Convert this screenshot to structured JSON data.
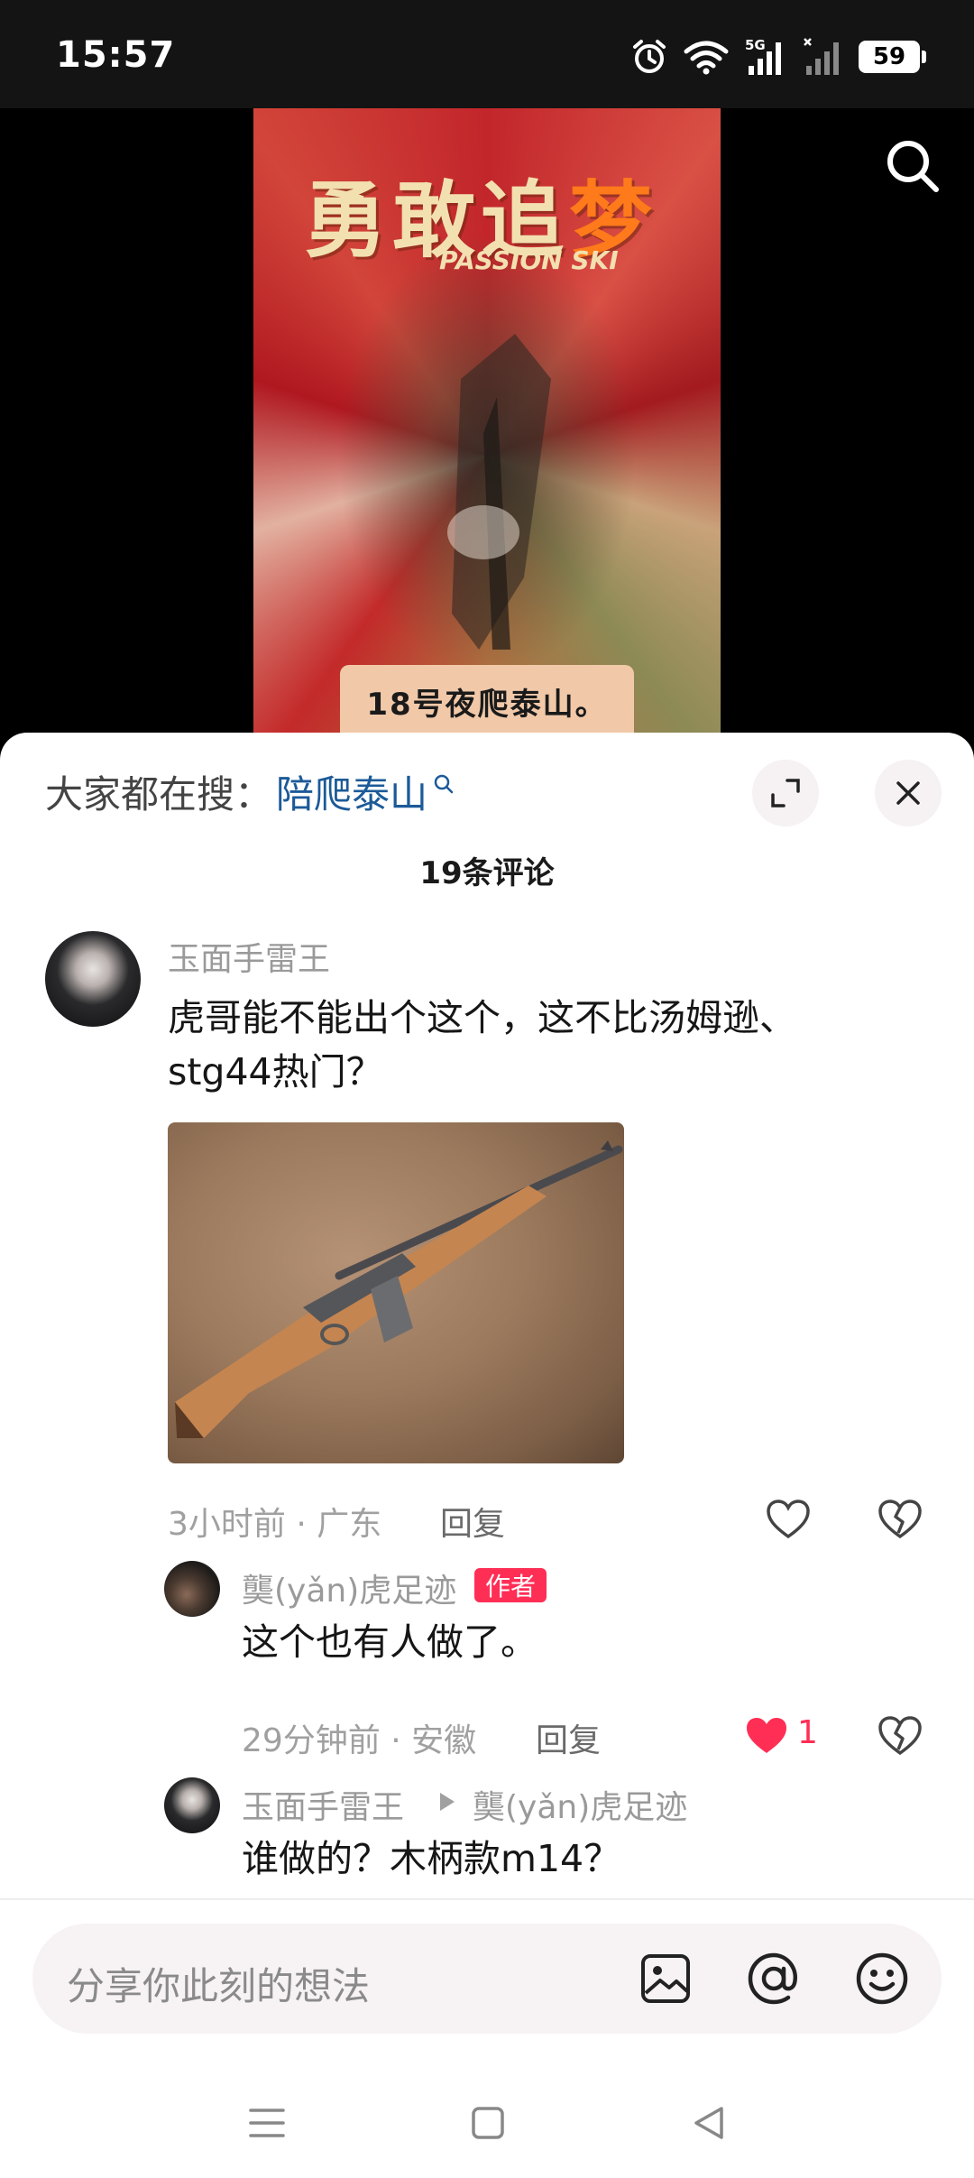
{
  "status_bar": {
    "time": "15:57",
    "network": "5G",
    "battery": "59"
  },
  "video": {
    "title_main": "勇敢追",
    "title_accent": "梦",
    "title_sub": "PASSION SKI",
    "caption": "18号夜爬泰山。"
  },
  "sheet": {
    "trending_prefix": "大家都在搜：",
    "trending_query": "陪爬泰山",
    "comment_count": "19条评论"
  },
  "comments": [
    {
      "user": "玉面手雷王",
      "text_line1": "虎哥能不能出个这个，这不比汤姆逊、",
      "text_line2": "stg44热门？",
      "meta": "3小时前 · 广东",
      "reply_label": "回复"
    },
    {
      "user": "龑(yǎn)虎足迹",
      "badge": "作者",
      "text": "这个也有人做了。",
      "meta": "29分钟前 · 安徽",
      "reply_label": "回复",
      "likes": "1"
    },
    {
      "user": "玉面手雷王",
      "reply_to": "龑(yǎn)虎足迹",
      "text": "谁做的？木柄款m14？"
    }
  ],
  "input": {
    "placeholder": "分享你此刻的想法"
  },
  "colors": {
    "link": "#1c5a98",
    "badge": "#ff2e55",
    "like_active": "#ff2e55"
  }
}
